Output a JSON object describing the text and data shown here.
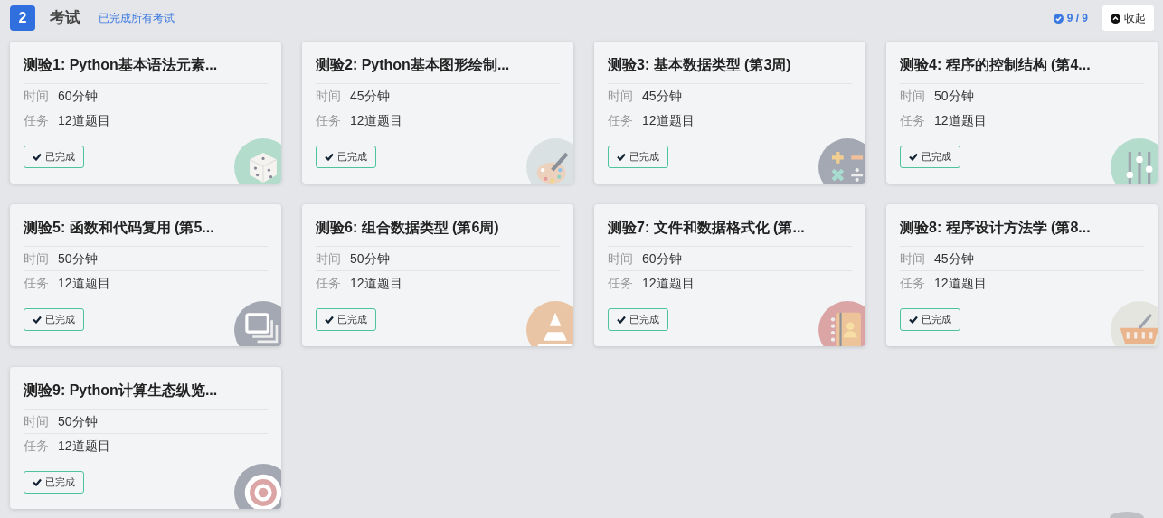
{
  "section": {
    "number": "2",
    "title": "考试",
    "subtitle": "已完成所有考试",
    "progress": "9 / 9",
    "collapse_button": "收起"
  },
  "quizzes": [
    {
      "title": "测验1: Python基本语法元素...",
      "time_label": "时间",
      "time": "60分钟",
      "task_label": "任务",
      "tasks": "12道题目",
      "status": "已完成",
      "done": true
    },
    {
      "title": "测验2: Python基本图形绘制...",
      "time_label": "时间",
      "time": "45分钟",
      "task_label": "任务",
      "tasks": "12道题目",
      "status": "已完成",
      "done": true
    },
    {
      "title": "测验3: 基本数据类型 (第3周)",
      "time_label": "时间",
      "time": "45分钟",
      "task_label": "任务",
      "tasks": "12道题目",
      "status": "已完成",
      "done": true
    },
    {
      "title": "测验4: 程序的控制结构 (第4...",
      "time_label": "时间",
      "time": "50分钟",
      "task_label": "任务",
      "tasks": "12道题目",
      "status": "已完成",
      "done": true
    },
    {
      "title": "测验5: 函数和代码复用 (第5...",
      "time_label": "时间",
      "time": "50分钟",
      "task_label": "任务",
      "tasks": "12道题目",
      "status": "已完成",
      "done": true
    },
    {
      "title": "测验6: 组合数据类型 (第6周)",
      "time_label": "时间",
      "time": "50分钟",
      "task_label": "任务",
      "tasks": "12道题目",
      "status": "已完成",
      "done": true
    },
    {
      "title": "测验7: 文件和数据格式化 (第...",
      "time_label": "时间",
      "time": "60分钟",
      "task_label": "任务",
      "tasks": "12道题目",
      "status": "已完成",
      "done": true
    },
    {
      "title": "测验8: 程序设计方法学 (第8...",
      "time_label": "时间",
      "time": "45分钟",
      "task_label": "任务",
      "tasks": "12道题目",
      "status": "已完成",
      "done": true
    },
    {
      "title": "测验9: Python计算生态纵览...",
      "time_label": "时间",
      "time": "50分钟",
      "task_label": "任务",
      "tasks": "12道题目",
      "status": "已完成",
      "done": true
    }
  ]
}
